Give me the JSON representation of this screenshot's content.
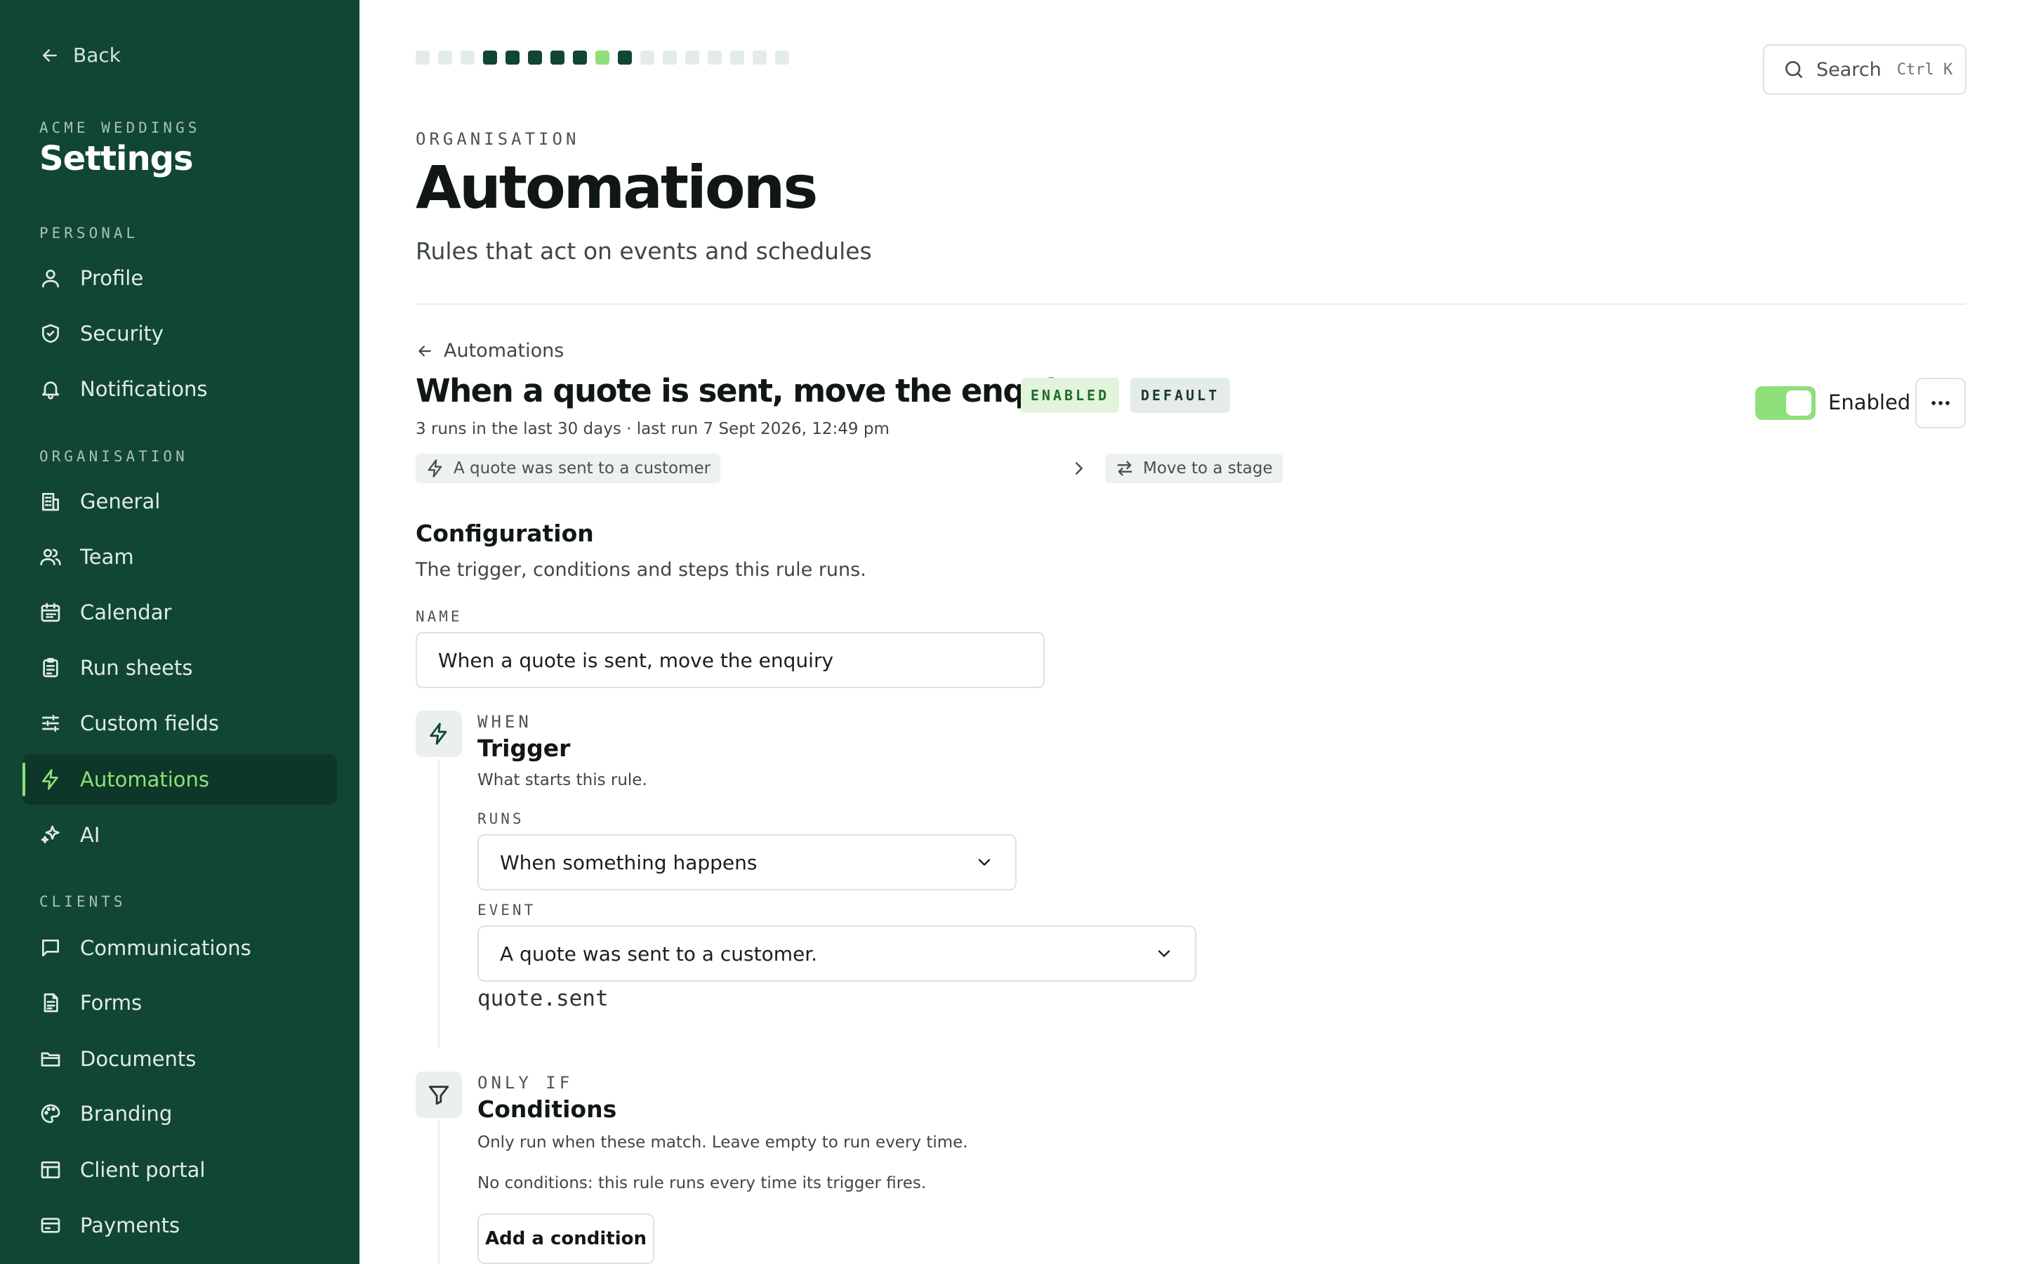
{
  "sidebar": {
    "back_label": "Back",
    "org_name": "ACME WEDDINGS",
    "title": "Settings",
    "sections": {
      "personal": "PERSONAL",
      "organisation": "ORGANISATION",
      "clients": "CLIENTS"
    },
    "items": [
      {
        "label": "Profile",
        "icon": "user-icon"
      },
      {
        "label": "Security",
        "icon": "shield-icon"
      },
      {
        "label": "Notifications",
        "icon": "bell-icon"
      },
      {
        "label": "General",
        "icon": "building-icon"
      },
      {
        "label": "Team",
        "icon": "users-icon"
      },
      {
        "label": "Calendar",
        "icon": "calendar-icon"
      },
      {
        "label": "Run sheets",
        "icon": "clipboard-icon"
      },
      {
        "label": "Custom fields",
        "icon": "sliders-icon"
      },
      {
        "label": "Automations",
        "icon": "bolt-icon",
        "active": true
      },
      {
        "label": "AI",
        "icon": "sparkles-icon"
      },
      {
        "label": "Communications",
        "icon": "message-icon"
      },
      {
        "label": "Forms",
        "icon": "form-icon"
      },
      {
        "label": "Documents",
        "icon": "folder-icon"
      },
      {
        "label": "Branding",
        "icon": "palette-icon"
      },
      {
        "label": "Client portal",
        "icon": "layout-icon"
      },
      {
        "label": "Payments",
        "icon": "card-icon"
      }
    ],
    "active_color": "#8fe07a",
    "bg_color": "#114634"
  },
  "search": {
    "label": "Search",
    "shortcut": "Ctrl K"
  },
  "progress": {
    "steps": 17,
    "states": [
      "light",
      "light",
      "light",
      "dark",
      "dark",
      "dark",
      "dark",
      "dark",
      "green",
      "dark",
      "light",
      "light",
      "light",
      "light",
      "light",
      "light",
      "light"
    ]
  },
  "header": {
    "eyebrow": "ORGANISATION",
    "title": "Automations",
    "subtitle": "Rules that act on events and schedules"
  },
  "rule": {
    "breadcrumb": "Automations",
    "title": "When a quote is sent, move the enquiry",
    "badge_enabled": "ENABLED",
    "badge_default": "DEFAULT",
    "meta": "3 runs in the last 30 days · last run 7 Sept 2026, 12:49 pm",
    "trigger_chip": "A quote was sent to a customer",
    "action_chip": "Move to a stage",
    "toggle_label": "Enabled",
    "enabled": true
  },
  "configuration": {
    "title": "Configuration",
    "subtitle": "The trigger, conditions and steps this rule runs.",
    "name_label": "NAME",
    "name_value": "When a quote is sent, move the enquiry"
  },
  "trigger": {
    "eyebrow": "WHEN",
    "title": "Trigger",
    "subtitle": "What starts this rule.",
    "runs_label": "RUNS",
    "runs_value": "When something happens",
    "event_label": "EVENT",
    "event_value": "A quote was sent to a customer.",
    "event_code": "quote.sent"
  },
  "conditions": {
    "eyebrow": "ONLY IF",
    "title": "Conditions",
    "subtitle": "Only run when these match. Leave empty to run every time.",
    "empty_text": "No conditions: this rule runs every time its trigger fires.",
    "add_button": "Add a condition"
  }
}
